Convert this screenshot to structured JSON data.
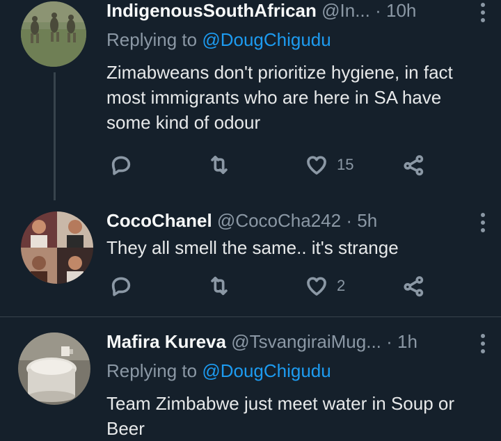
{
  "tweets": [
    {
      "name": "IndigenousSouthAfrican",
      "handle": "@In...",
      "dot": "·",
      "time": "10h",
      "replying_label": "Replying to",
      "replying_to": "@DougChigudu",
      "text": "Zimabweans don't prioritize hygiene, in fact most immigrants who are here in SA have some kind of odour",
      "likes": "15"
    },
    {
      "name": "CocoChanel",
      "handle": "@CocoCha242",
      "dot": "·",
      "time": "5h",
      "text": "They all smell the same.. it's strange",
      "likes": "2"
    },
    {
      "name": "Mafira Kureva",
      "handle": "@TsvangiraiMug...",
      "dot": "·",
      "time": "1h",
      "replying_label": "Replying to",
      "replying_to": "@DougChigudu",
      "text": "Team Zimbabwe just meet water in Soup or Beer"
    }
  ],
  "icons": {
    "reply": "reply-icon",
    "retweet": "retweet-icon",
    "like": "heart-icon",
    "share": "share-icon",
    "more": "more-icon"
  },
  "colors": {
    "background": "#15202b",
    "mention": "#1d9bf0",
    "muted": "#8b98a5",
    "divider": "#38444d"
  }
}
